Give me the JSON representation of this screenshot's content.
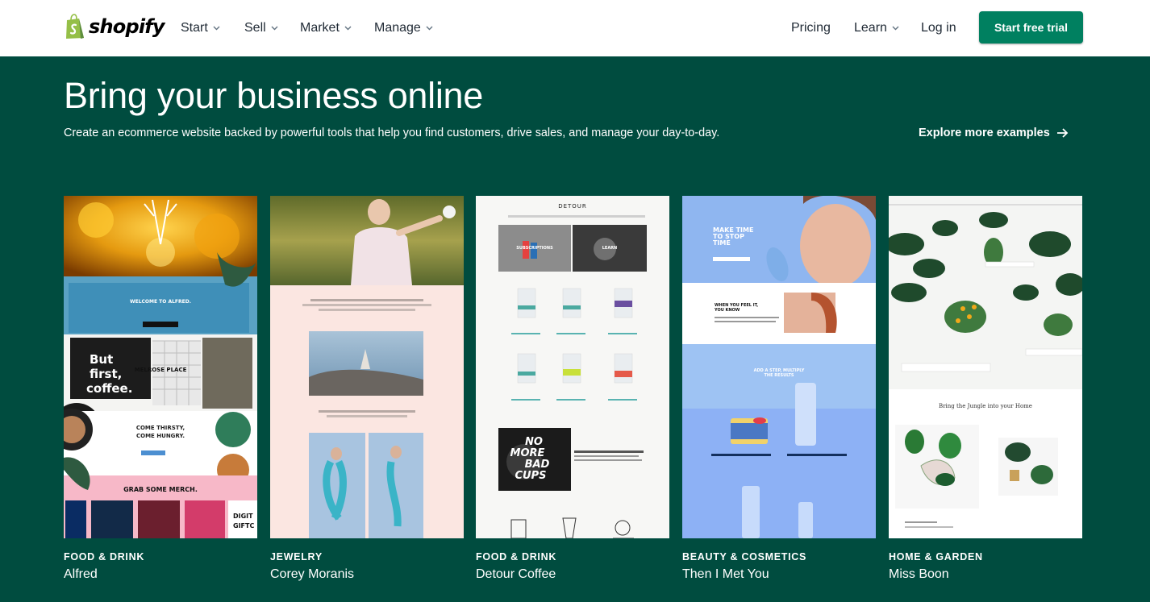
{
  "nav": {
    "brand": "shopify",
    "items": [
      {
        "label": "Start"
      },
      {
        "label": "Sell"
      },
      {
        "label": "Market"
      },
      {
        "label": "Manage"
      }
    ],
    "right": {
      "pricing": "Pricing",
      "learn": "Learn",
      "login": "Log in",
      "trial": "Start free trial"
    }
  },
  "hero": {
    "title": "Bring your business online",
    "subtitle": "Create an ecommerce website backed by powerful tools that help you find customers, drive sales, and manage your day-to-day.",
    "explore": "Explore more examples"
  },
  "examples": [
    {
      "category": "FOOD & DRINK",
      "name": "Alfred"
    },
    {
      "category": "JEWELRY",
      "name": "Corey Moranis"
    },
    {
      "category": "FOOD & DRINK",
      "name": "Detour Coffee"
    },
    {
      "category": "BEAUTY & COSMETICS",
      "name": "Then I Met You"
    },
    {
      "category": "HOME & GARDEN",
      "name": "Miss Boon"
    }
  ],
  "thumbs": {
    "alfred": {
      "welcome": "WELCOME TO ALFRED.",
      "but": "But",
      "first": "first,",
      "coffee": "coffee.",
      "melrose": "MELROSE PLACE",
      "thirsty": "COME THIRSTY,",
      "hungry": "COME HUNGRY.",
      "merch": "GRAB SOME MERCH.",
      "digital": "DIGIT",
      "giftc": "GIFTC"
    },
    "detour": {
      "logo": "DETOUR",
      "subscriptions": "SUBSCRIPTIONS",
      "learn": "LEARN",
      "no": "NO",
      "more": "MORE",
      "bad": "BAD",
      "cups": "CUPS"
    },
    "timy": {
      "make_time": "MAKE TIME",
      "to_stop": "TO STOP",
      "time": "TIME",
      "when_you_feel": "WHEN YOU FEEL IT,",
      "you_know": "YOU KNOW",
      "add_step": "ADD A STEP, MULTIPLY",
      "the_results": "THE RESULTS"
    },
    "missboon": {
      "tagline": "Bring the Jungle into your Home"
    }
  },
  "colors": {
    "brand_green": "#004c3f",
    "button_green": "#008060",
    "nav_bg": "#ffffff",
    "nav_text": "#212b36"
  }
}
